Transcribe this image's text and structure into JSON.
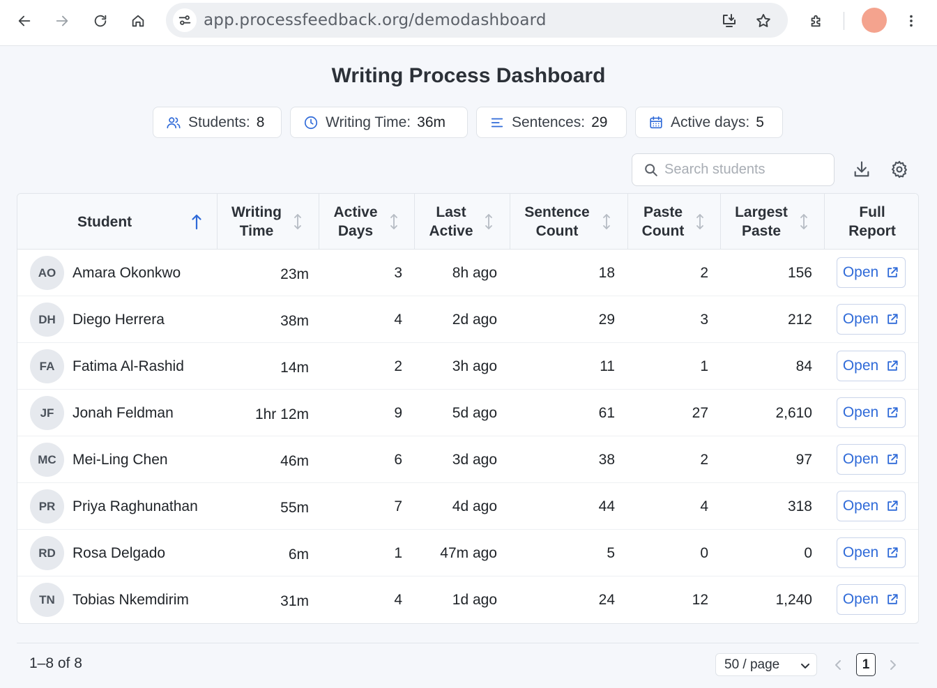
{
  "browser": {
    "url": "app.processfeedback.org/demodashboard"
  },
  "page": {
    "title": "Writing Process Dashboard"
  },
  "stats": [
    {
      "label": "Students:",
      "value": "8",
      "icon": "users-icon"
    },
    {
      "label": "Writing Time:",
      "value": "36m",
      "icon": "clock-icon"
    },
    {
      "label": "Sentences:",
      "value": "29",
      "icon": "lines-icon"
    },
    {
      "label": "Active days:",
      "value": "5",
      "icon": "calendar-icon"
    }
  ],
  "search": {
    "placeholder": "Search students"
  },
  "table": {
    "columns": [
      {
        "line1": "Student",
        "line2": ""
      },
      {
        "line1": "Writing",
        "line2": "Time"
      },
      {
        "line1": "Active",
        "line2": "Days"
      },
      {
        "line1": "Last",
        "line2": "Active"
      },
      {
        "line1": "Sentence",
        "line2": "Count"
      },
      {
        "line1": "Paste",
        "line2": "Count"
      },
      {
        "line1": "Largest",
        "line2": "Paste"
      },
      {
        "line1": "Full",
        "line2": "Report"
      }
    ],
    "sorted_by": "Student",
    "sort_direction": "ascending",
    "open_label": "Open",
    "rows": [
      {
        "initials": "AO",
        "name": "Amara Okonkwo",
        "writing_time": "23m",
        "active_days": "3",
        "last_active": "8h ago",
        "sentence_count": "18",
        "paste_count": "2",
        "largest_paste": "156"
      },
      {
        "initials": "DH",
        "name": "Diego Herrera",
        "writing_time": "38m",
        "active_days": "4",
        "last_active": "2d ago",
        "sentence_count": "29",
        "paste_count": "3",
        "largest_paste": "212"
      },
      {
        "initials": "FA",
        "name": "Fatima Al-Rashid",
        "writing_time": "14m",
        "active_days": "2",
        "last_active": "3h ago",
        "sentence_count": "11",
        "paste_count": "1",
        "largest_paste": "84"
      },
      {
        "initials": "JF",
        "name": "Jonah Feldman",
        "writing_time": "1hr 12m",
        "active_days": "9",
        "last_active": "5d ago",
        "sentence_count": "61",
        "paste_count": "27",
        "largest_paste": "2,610"
      },
      {
        "initials": "MC",
        "name": "Mei-Ling Chen",
        "writing_time": "46m",
        "active_days": "6",
        "last_active": "3d ago",
        "sentence_count": "38",
        "paste_count": "2",
        "largest_paste": "97"
      },
      {
        "initials": "PR",
        "name": "Priya Raghunathan",
        "writing_time": "55m",
        "active_days": "7",
        "last_active": "4d ago",
        "sentence_count": "44",
        "paste_count": "4",
        "largest_paste": "318"
      },
      {
        "initials": "RD",
        "name": "Rosa Delgado",
        "writing_time": "6m",
        "active_days": "1",
        "last_active": "47m ago",
        "sentence_count": "5",
        "paste_count": "0",
        "largest_paste": "0"
      },
      {
        "initials": "TN",
        "name": "Tobias Nkemdirim",
        "writing_time": "31m",
        "active_days": "4",
        "last_active": "1d ago",
        "sentence_count": "24",
        "paste_count": "12",
        "largest_paste": "1,240"
      }
    ]
  },
  "pagination": {
    "range": "1–8 of 8",
    "page_size": "50 / page",
    "current_page": "1"
  },
  "colors": {
    "accent": "#2f6ad8",
    "profile": "#f4a38e"
  }
}
